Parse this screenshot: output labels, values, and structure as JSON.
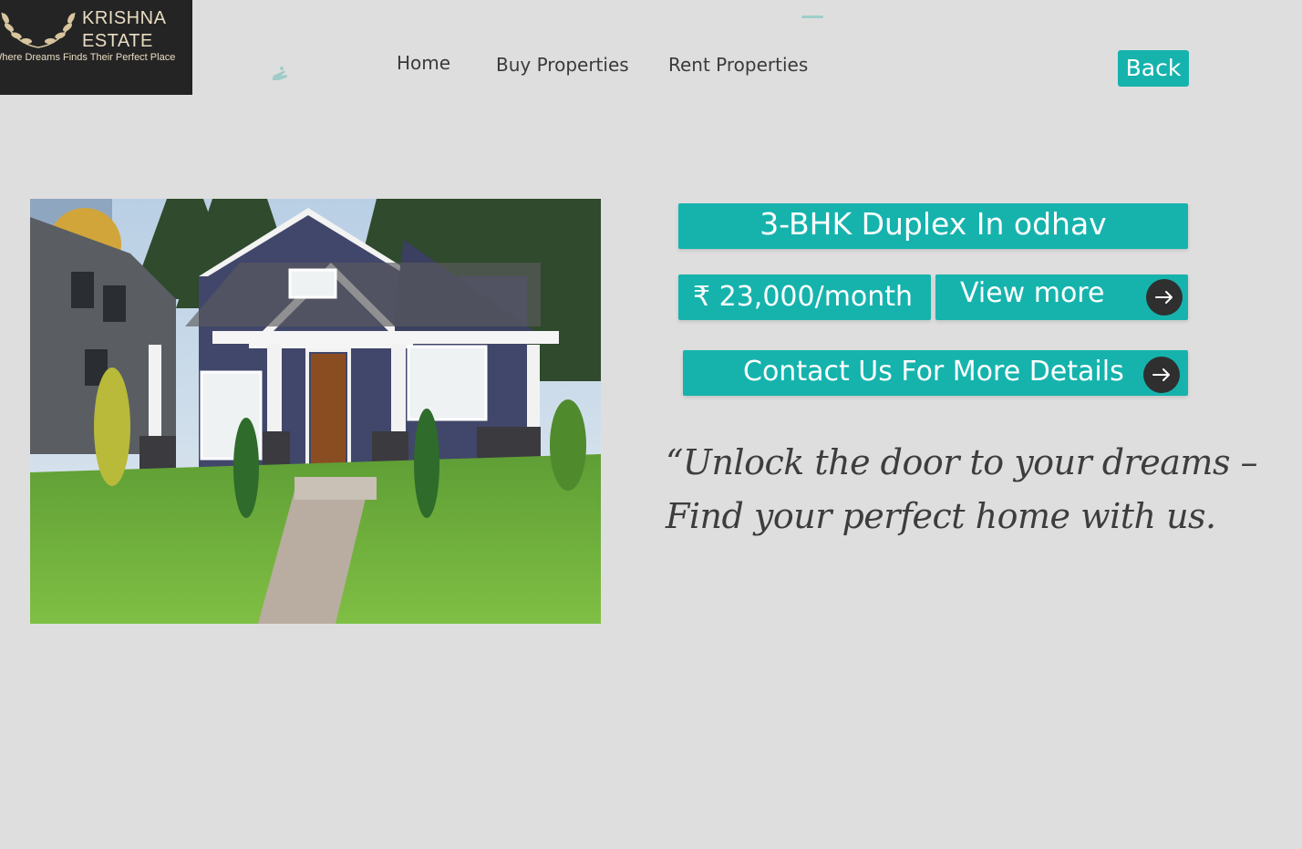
{
  "logo": {
    "brand_line1": "KRISHNA",
    "brand_line2": "ESTATE",
    "tagline": "Where Dreams Finds Their Perfect Place",
    "icon": "laurel-wreath-icon"
  },
  "nav": {
    "home": "Home",
    "buy": "Buy Properties",
    "rent": "Rent Properties"
  },
  "header": {
    "back_label": "Back"
  },
  "property": {
    "title": "3-BHK Duplex In odhav",
    "price": "₹ 23,000/month",
    "view_more": "View more",
    "contact": "Contact Us For More Details",
    "quote": "“Unlock the door to your dreams – Find your perfect home with us."
  },
  "icons": {
    "arrow": "arrow-right-icon",
    "deco": "hand-icon"
  },
  "colors": {
    "accent": "#16b3ad",
    "background": "#dedede",
    "logo_bg": "#242424",
    "arrow_bg": "#2f2f2f"
  }
}
